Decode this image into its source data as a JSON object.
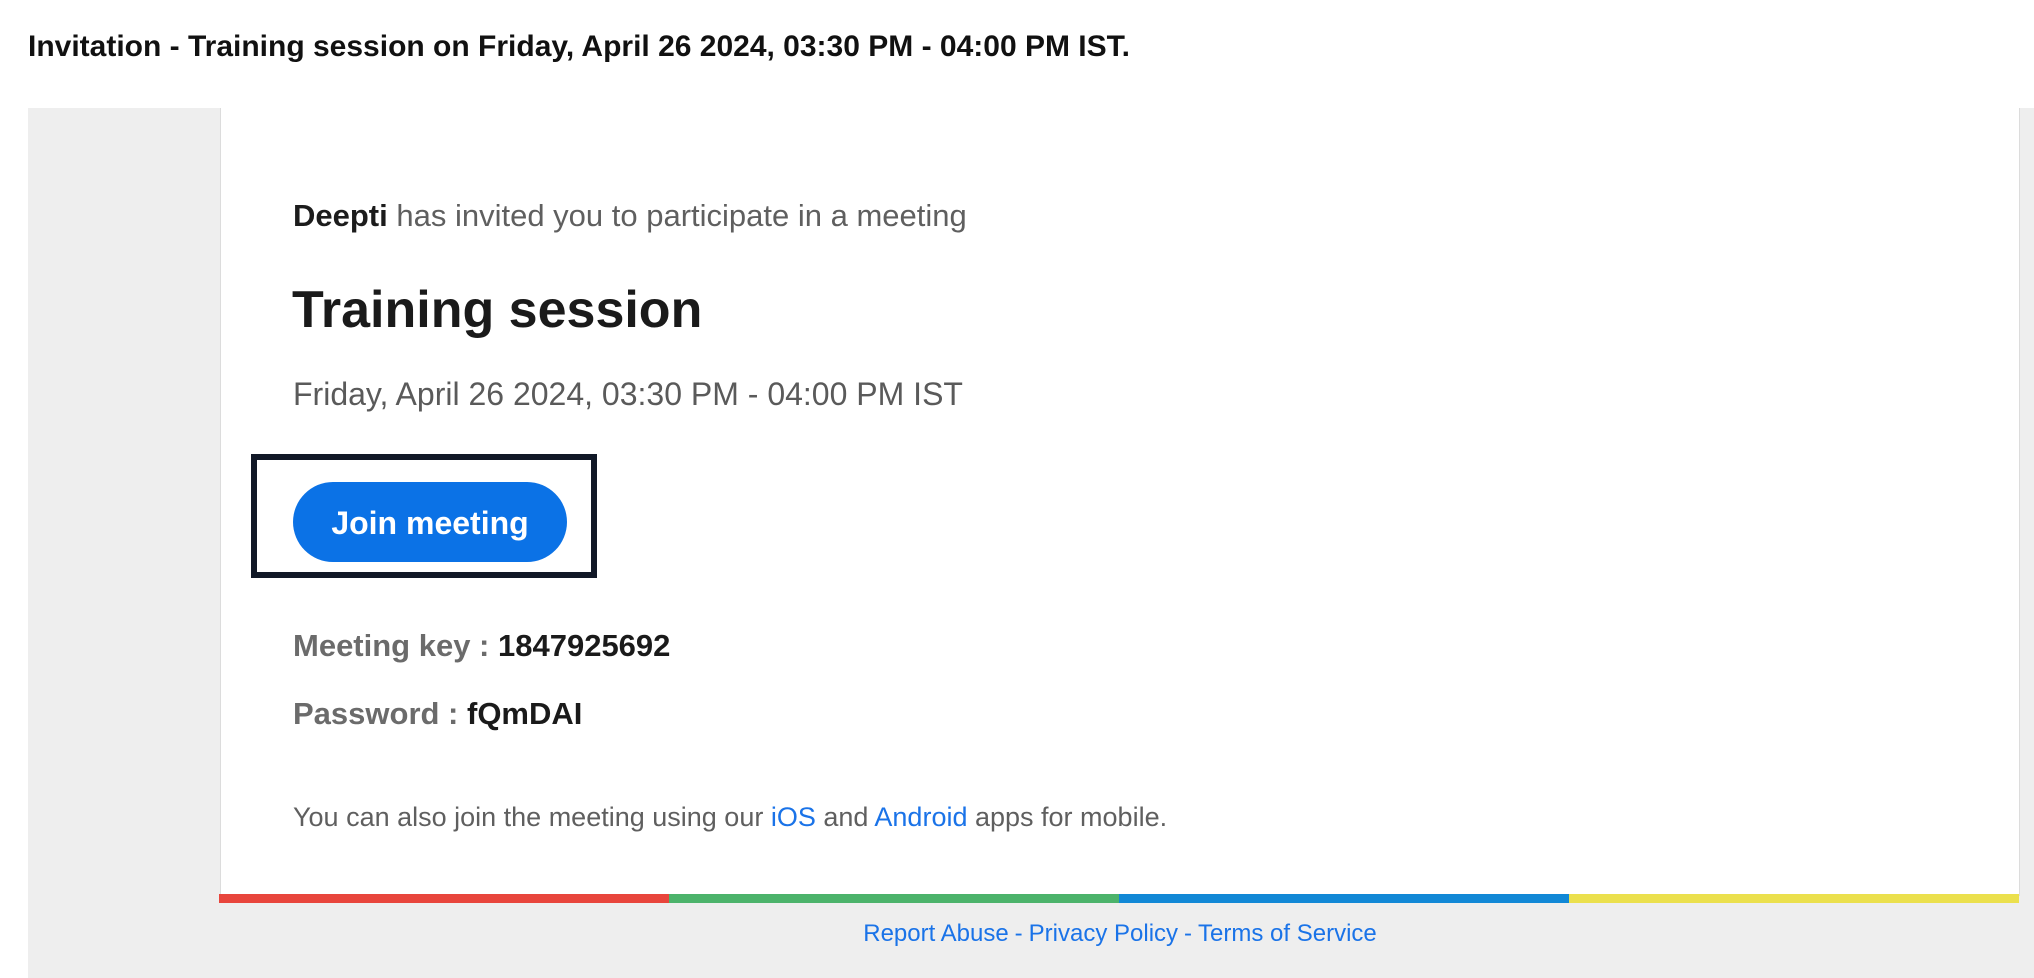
{
  "subject": {
    "title": "Invitation - Training session on Friday, April 26 2024, 03:30 PM - 04:00 PM IST."
  },
  "invitation": {
    "host_name": "Deepti",
    "invite_text": " has invited you to participate in a meeting",
    "meeting_title": "Training session",
    "meeting_time": "Friday, April 26 2024, 03:30 PM - 04:00 PM IST",
    "join_label": "Join meeting",
    "meeting_key_label": "Meeting key : ",
    "meeting_key": "1847925692",
    "password_label": "Password : ",
    "password": "fQmDAI",
    "mobile_prefix": "You can also join the meeting using our ",
    "ios_label": "iOS",
    "mobile_and": " and ",
    "android_label": "Android",
    "mobile_suffix": " apps for mobile."
  },
  "strip_colors": [
    "#e8453c",
    "#4cb36b",
    "#1188d6",
    "#ebe04d"
  ],
  "footer": {
    "report_abuse": "Report Abuse",
    "privacy_policy": "Privacy Policy",
    "terms_of_service": "Terms of Service",
    "separator": "-"
  },
  "colors": {
    "accent": "#0b72e6",
    "link": "#1a73e8",
    "frame_background": "#eeeeee",
    "highlight_border": "#111827"
  }
}
